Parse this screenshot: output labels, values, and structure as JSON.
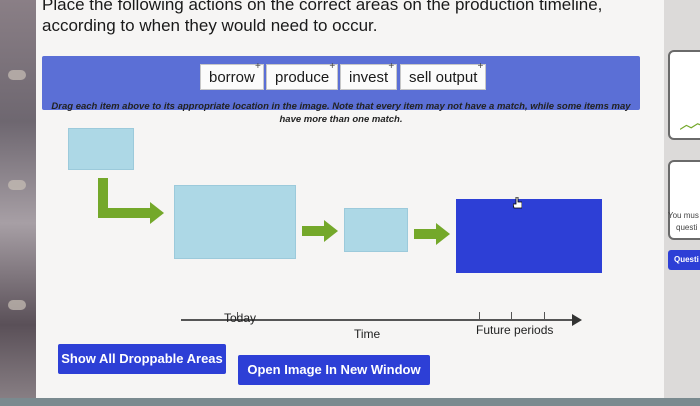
{
  "question": "Place the following actions on the correct areas on the production timeline, according to when they would need to occur.",
  "word_bank": [
    {
      "label": "borrow",
      "badge": "+"
    },
    {
      "label": "produce",
      "badge": "+"
    },
    {
      "label": "invest",
      "badge": "+"
    },
    {
      "label": "sell output",
      "badge": "+"
    }
  ],
  "instruction": "Drag each item above to its appropriate location in the image. Note that every item may not have a match, while some items may have more than one match.",
  "diagram": {
    "today_label": "Today",
    "time_label": "Time",
    "future_label": "Future periods"
  },
  "buttons": {
    "show_droppable": "Show All Droppable Areas",
    "open_image": "Open Image In New Window"
  },
  "right_panel": {
    "line1": "You mus",
    "line2": "questi",
    "button": "Questi"
  },
  "colors": {
    "bank_blue": "#5b6fd6",
    "drop_light": "#add8e6",
    "drop_dark": "#2d3fd6",
    "arrow_green": "#74a82a"
  }
}
